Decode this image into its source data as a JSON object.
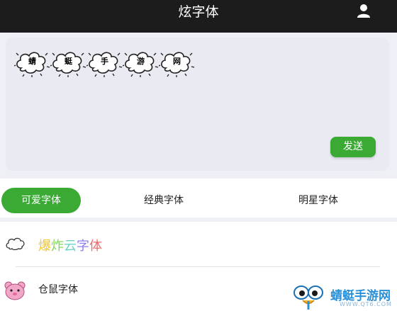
{
  "header": {
    "title": "炫字体",
    "user_icon": "user-icon"
  },
  "editor": {
    "preview_chars": [
      "蜻",
      "蜓",
      "手",
      "游",
      "网"
    ],
    "preview_style": "cloud-outline",
    "send_label": "发送"
  },
  "tabs": [
    {
      "label": "可爱字体",
      "active": true
    },
    {
      "label": "经典字体",
      "active": false
    },
    {
      "label": "明星字体",
      "active": false
    }
  ],
  "font_list": [
    {
      "name": "爆炸云字体",
      "icon": "cloud-icon",
      "rainbow_colors": [
        "#f3c623",
        "#7ed957",
        "#6fd3c1",
        "#8a7ff0",
        "#f06a6a"
      ]
    },
    {
      "name": "仓鼠字体",
      "icon": "hamster-icon"
    }
  ],
  "watermark": {
    "text": "蜻蜓手游网",
    "sub": "WWW.QT6.COM"
  },
  "colors": {
    "accent": "#3aaa35",
    "header_bg": "#1c1c1c",
    "panel_bg": "#e9eaf2"
  }
}
